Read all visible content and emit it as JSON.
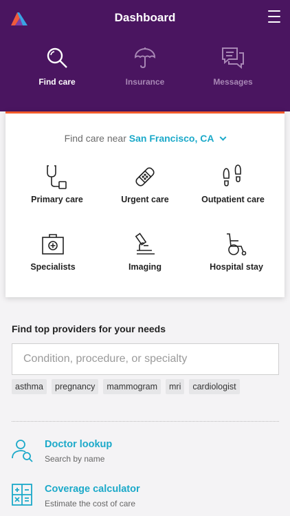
{
  "header": {
    "title": "Dashboard",
    "logo_icon": "app-logo",
    "menu_icon": "hamburger-menu-icon",
    "background": "#4a1560",
    "tabs": [
      {
        "label": "Find care",
        "icon": "search-icon",
        "active": true
      },
      {
        "label": "Insurance",
        "icon": "umbrella-icon",
        "active": false
      },
      {
        "label": "Messages",
        "icon": "messages-icon",
        "active": false
      }
    ]
  },
  "care_card": {
    "near_prefix": "Find care near",
    "location": "San Francisco, CA",
    "accent": "#1ba9c9",
    "top_border": "#f25b2a",
    "options": [
      {
        "label": "Primary care",
        "icon": "stethoscope-icon"
      },
      {
        "label": "Urgent care",
        "icon": "bandage-icon"
      },
      {
        "label": "Outpatient care",
        "icon": "footprints-icon"
      },
      {
        "label": "Specialists",
        "icon": "medical-kit-icon"
      },
      {
        "label": "Imaging",
        "icon": "microscope-icon"
      },
      {
        "label": "Hospital stay",
        "icon": "wheelchair-icon"
      }
    ]
  },
  "providers": {
    "title": "Find top providers for your needs",
    "search_placeholder": "Condition, procedure, or specialty",
    "tags": [
      "asthma",
      "pregnancy",
      "mammogram",
      "mri",
      "cardiologist"
    ]
  },
  "tools": [
    {
      "title": "Doctor lookup",
      "subtitle": "Search by name",
      "icon": "doctor-search-icon"
    },
    {
      "title": "Coverage calculator",
      "subtitle": "Estimate the cost of care",
      "icon": "calculator-icon"
    }
  ]
}
